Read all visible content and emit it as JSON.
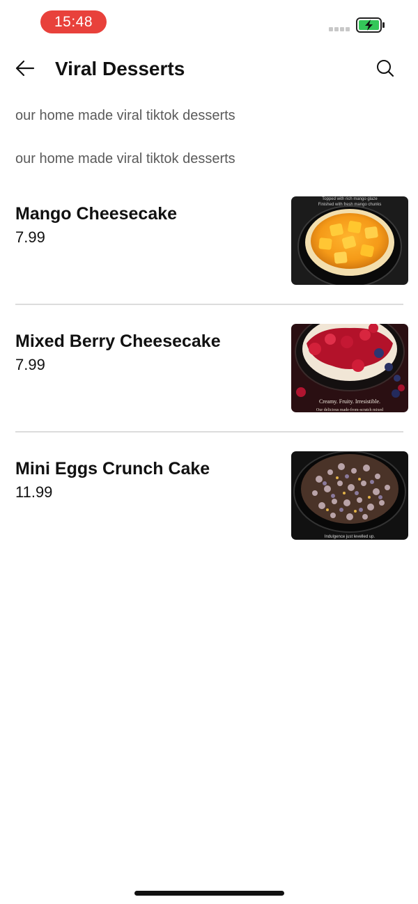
{
  "status_bar": {
    "time": "15:48",
    "battery_icon": "battery-charging-icon",
    "signal_icon": "signal-icon",
    "accent_color": "#e8413b"
  },
  "header": {
    "title": "Viral Desserts",
    "back_icon": "arrow-left-icon",
    "search_icon": "search-icon"
  },
  "descriptions": [
    "our home made viral tiktok desserts",
    "our home made viral tiktok desserts"
  ],
  "items": [
    {
      "name": "Mango Cheesecake",
      "price": "7.99",
      "image_caption_top": "Topped with rich mango glaze",
      "image_caption_bottom": "Finished with fresh mango chunks"
    },
    {
      "name": "Mixed Berry Cheesecake",
      "price": "7.99",
      "image_caption_top": "Creamy. Fruity. Irresistible.",
      "image_caption_bottom": "Our delicious made-from-scratch mixed"
    },
    {
      "name": "Mini Eggs Crunch Cake",
      "price": "11.99",
      "image_caption_top": "Indulgence just levelled up."
    }
  ]
}
